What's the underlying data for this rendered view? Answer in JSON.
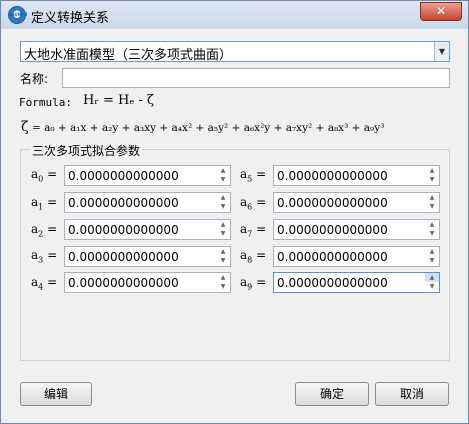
{
  "window": {
    "title": "定义转换关系",
    "close_glyph": "✕",
    "icon_text": "LAUNCH"
  },
  "model_select": {
    "value": "大地水准面模型（三次多项式曲面）",
    "arrow": "▼"
  },
  "name_field": {
    "label": "名称:",
    "value": ""
  },
  "formula": {
    "label": "Formula:",
    "expression": "Hᵣ = Hₑ - ζ"
  },
  "polynomial": {
    "zeta": "ζ",
    "expression": "= a₀ + a₁x + a₂y + a₃xy + a₄x² + a₅y² + a₆x²y + a₇xy² + a₈x³ + a₉y³"
  },
  "coefficients": {
    "group_title": "三次多项式拟合参数",
    "items": [
      {
        "label_base": "a",
        "label_sub": "0",
        "suffix": " =",
        "value": "0.0000000000000"
      },
      {
        "label_base": "a",
        "label_sub": "1",
        "suffix": " =",
        "value": "0.0000000000000"
      },
      {
        "label_base": "a",
        "label_sub": "2",
        "suffix": " =",
        "value": "0.0000000000000"
      },
      {
        "label_base": "a",
        "label_sub": "3",
        "suffix": " =",
        "value": "0.0000000000000"
      },
      {
        "label_base": "a",
        "label_sub": "4",
        "suffix": " =",
        "value": "0.0000000000000"
      },
      {
        "label_base": "a",
        "label_sub": "5",
        "suffix": " =",
        "value": "0.0000000000000"
      },
      {
        "label_base": "a",
        "label_sub": "6",
        "suffix": " =",
        "value": "0.0000000000000"
      },
      {
        "label_base": "a",
        "label_sub": "7",
        "suffix": " =",
        "value": "0.0000000000000"
      },
      {
        "label_base": "a",
        "label_sub": "8",
        "suffix": " =",
        "value": "0.0000000000000"
      },
      {
        "label_base": "a",
        "label_sub": "9",
        "suffix": " =",
        "value": "0.0000000000000"
      }
    ]
  },
  "spin_glyphs": {
    "up": "▲",
    "down": "▼"
  },
  "buttons": {
    "edit": "编辑",
    "ok": "确定",
    "cancel": "取消"
  }
}
